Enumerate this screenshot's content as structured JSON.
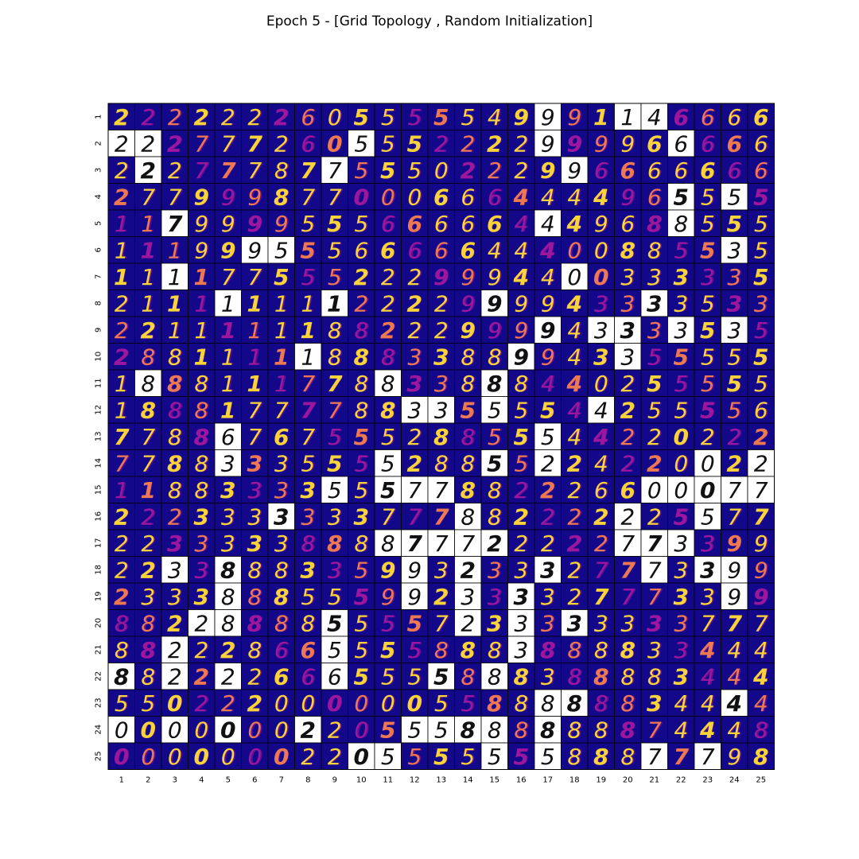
{
  "chart_data": {
    "type": "heatmap",
    "title": "Epoch 5 - [Grid Topology , Random Initialization]",
    "grid_size": [
      25,
      25
    ],
    "x_ticks": [
      "1",
      "2",
      "3",
      "4",
      "5",
      "6",
      "7",
      "8",
      "9",
      "10",
      "11",
      "12",
      "13",
      "14",
      "15",
      "16",
      "17",
      "18",
      "19",
      "20",
      "21",
      "22",
      "23",
      "24",
      "25"
    ],
    "y_ticks": [
      "1",
      "2",
      "3",
      "4",
      "5",
      "6",
      "7",
      "8",
      "9",
      "10",
      "11",
      "12",
      "13",
      "14",
      "15",
      "16",
      "17",
      "18",
      "19",
      "20",
      "21",
      "22",
      "23",
      "24",
      "25"
    ],
    "cell_digits": [
      "2222222605555549991146",
      "2227772605552222999966",
      "2227778775550222996666",
      "2779998770006664444965",
      "1179999555666664449688",
      "1119995556666644400885",
      "1111775552229994400333",
      "2111111112222999943333",
      "2211111188222999943333",
      "2881111188833889943355",
      "1888111778833888440255",
      "1888177778833555544255",
      "7788676755528855544220",
      "7788333555528855224220",
      "1188333355577882226600",
      "2223333333777882222225",
      "2233333888877722222773",
      "2233888335993233327773",
      "2333888555992333327773",
      "8822888855557233333333",
      "8822286655558883888833",
      "8822226665555888388883",
      "5502220000005588888834",
      "0000000220555888888874",
      "0000000220555555588877"
    ],
    "cell_digits_tail": [
      "666",
      "666",
      "666",
      "555",
      "555",
      "535",
      "335",
      "533",
      "535",
      "555",
      "555",
      "556",
      "222",
      "022",
      "077",
      "577",
      "399",
      "399",
      "399",
      "777",
      "444",
      "444",
      "444",
      "448",
      "798"
    ],
    "highlighted_cells": [
      [
        1,
        17
      ],
      [
        1,
        20
      ],
      [
        1,
        21
      ],
      [
        2,
        1
      ],
      [
        2,
        2
      ],
      [
        2,
        10
      ],
      [
        2,
        17
      ],
      [
        2,
        22
      ],
      [
        3,
        2
      ],
      [
        3,
        9
      ],
      [
        3,
        18
      ],
      [
        4,
        22
      ],
      [
        4,
        24
      ],
      [
        5,
        3
      ],
      [
        5,
        17
      ],
      [
        5,
        22
      ],
      [
        6,
        6
      ],
      [
        6,
        7
      ],
      [
        6,
        24
      ],
      [
        7,
        3
      ],
      [
        7,
        18
      ],
      [
        8,
        5
      ],
      [
        8,
        9
      ],
      [
        8,
        15
      ],
      [
        8,
        21
      ],
      [
        9,
        17
      ],
      [
        9,
        19
      ],
      [
        9,
        20
      ],
      [
        9,
        22
      ],
      [
        9,
        24
      ],
      [
        10,
        8
      ],
      [
        10,
        16
      ],
      [
        10,
        20
      ],
      [
        11,
        2
      ],
      [
        11,
        11
      ],
      [
        11,
        15
      ],
      [
        12,
        12
      ],
      [
        12,
        13
      ],
      [
        12,
        15
      ],
      [
        12,
        19
      ],
      [
        13,
        5
      ],
      [
        13,
        17
      ],
      [
        14,
        5
      ],
      [
        14,
        11
      ],
      [
        14,
        15
      ],
      [
        14,
        17
      ],
      [
        14,
        23
      ],
      [
        14,
        25
      ],
      [
        15,
        9
      ],
      [
        15,
        11
      ],
      [
        15,
        12
      ],
      [
        15,
        13
      ],
      [
        15,
        21
      ],
      [
        15,
        22
      ],
      [
        15,
        23
      ],
      [
        15,
        24
      ],
      [
        15,
        25
      ],
      [
        16,
        7
      ],
      [
        16,
        14
      ],
      [
        16,
        20
      ],
      [
        16,
        23
      ],
      [
        17,
        11
      ],
      [
        17,
        12
      ],
      [
        17,
        13
      ],
      [
        17,
        14
      ],
      [
        17,
        15
      ],
      [
        17,
        20
      ],
      [
        17,
        21
      ],
      [
        17,
        22
      ],
      [
        18,
        3
      ],
      [
        18,
        5
      ],
      [
        18,
        12
      ],
      [
        18,
        14
      ],
      [
        18,
        17
      ],
      [
        18,
        21
      ],
      [
        18,
        23
      ],
      [
        18,
        24
      ],
      [
        19,
        5
      ],
      [
        19,
        12
      ],
      [
        19,
        14
      ],
      [
        19,
        16
      ],
      [
        19,
        24
      ],
      [
        20,
        4
      ],
      [
        20,
        5
      ],
      [
        20,
        9
      ],
      [
        20,
        14
      ],
      [
        20,
        16
      ],
      [
        20,
        18
      ],
      [
        21,
        3
      ],
      [
        21,
        9
      ],
      [
        21,
        16
      ],
      [
        22,
        1
      ],
      [
        22,
        3
      ],
      [
        22,
        5
      ],
      [
        22,
        9
      ],
      [
        22,
        13
      ],
      [
        22,
        15
      ],
      [
        23,
        17
      ],
      [
        23,
        18
      ],
      [
        23,
        24
      ],
      [
        24,
        1
      ],
      [
        24,
        3
      ],
      [
        24,
        5
      ],
      [
        24,
        8
      ],
      [
        24,
        12
      ],
      [
        24,
        13
      ],
      [
        24,
        14
      ],
      [
        24,
        15
      ],
      [
        24,
        17
      ],
      [
        25,
        10
      ],
      [
        25,
        11
      ],
      [
        25,
        15
      ],
      [
        25,
        17
      ],
      [
        25,
        21
      ],
      [
        25,
        23
      ]
    ],
    "colormap": "plasma",
    "highlight_style": "grayscale on white"
  },
  "colors": {
    "cell_background": "#14088a",
    "digit_hot": "#f9d33a",
    "digit_mid": "#ed7953",
    "digit_cool": "#9c179e",
    "highlight_background": "#ffffff",
    "highlight_digit": "#111111",
    "grid_line": "#000000"
  }
}
